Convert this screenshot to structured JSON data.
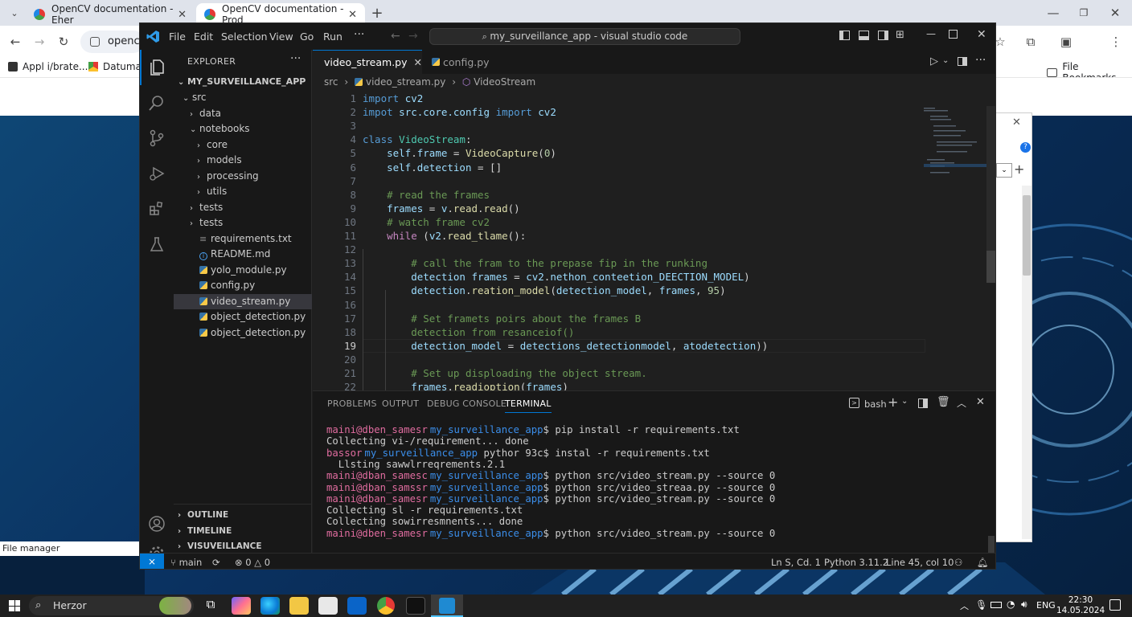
{
  "browser": {
    "tabs": [
      {
        "title": "OpenCV documentation - Eher",
        "active": false
      },
      {
        "title": "OpenCV documentation - Prod",
        "active": true
      }
    ],
    "address_text": "opencv",
    "bookmarks": [
      {
        "label": "Appl i/brate..."
      },
      {
        "label": "Datuman"
      }
    ],
    "bookmarks_folder": "File Bookmarks"
  },
  "desktop": {
    "file_manager_label": "File manager"
  },
  "vscode": {
    "menu": [
      "File",
      "Edit",
      "Selection",
      "View",
      "Go",
      "Run"
    ],
    "command_center": "my_surveillance_app - visual studio code",
    "explorer_title": "EXPLORER",
    "project_name": "MY_SURVEILLANCE_APP",
    "tree": [
      {
        "label": "src",
        "chevron": "⌄",
        "icon": "",
        "depth": 1
      },
      {
        "label": "data",
        "chevron": "›",
        "icon": "",
        "depth": 2
      },
      {
        "label": "notebooks",
        "chevron": "⌄",
        "icon": "",
        "depth": 2
      },
      {
        "label": "core",
        "chevron": "›",
        "icon": "",
        "depth": 3
      },
      {
        "label": "models",
        "chevron": "›",
        "icon": "",
        "depth": 3
      },
      {
        "label": "processing",
        "chevron": "›",
        "icon": "",
        "depth": 3
      },
      {
        "label": "utils",
        "chevron": "›",
        "icon": "",
        "depth": 3
      },
      {
        "label": "tests",
        "chevron": "›",
        "icon": "",
        "depth": 2
      },
      {
        "label": "tests",
        "chevron": "›",
        "icon": "",
        "depth": 2
      },
      {
        "label": "requirements.txt",
        "chevron": "",
        "icon": "text",
        "depth": 2
      },
      {
        "label": "README.md",
        "chevron": "",
        "icon": "info",
        "depth": 2
      },
      {
        "label": "yolo_module.py",
        "chevron": "",
        "icon": "python",
        "depth": 2
      },
      {
        "label": "config.py",
        "chevron": "",
        "icon": "python",
        "depth": 2
      },
      {
        "label": "video_stream.py",
        "chevron": "",
        "icon": "python",
        "depth": 2,
        "selected": true
      },
      {
        "label": "object_detection.py",
        "chevron": "",
        "icon": "python",
        "depth": 2
      },
      {
        "label": "object_detection.py",
        "chevron": "",
        "icon": "python",
        "depth": 2
      }
    ],
    "sidebar_sections": [
      "OUTLINE",
      "TIMELINE",
      "VISUVEILLANCE"
    ],
    "editor_tabs": [
      {
        "label": "video_stream.py",
        "active": true
      },
      {
        "label": "config.py",
        "active": false
      }
    ],
    "breadcrumb": {
      "folder": "src",
      "file": "video_stream.py",
      "symbol": "VideoStream"
    },
    "current_line": 19,
    "code": [
      {
        "n": 1,
        "tokens": [
          [
            "kw",
            "import"
          ],
          [
            "pun",
            " "
          ],
          [
            "var",
            "cv2"
          ]
        ]
      },
      {
        "n": 2,
        "tokens": [
          [
            "kw",
            "impot"
          ],
          [
            "pun",
            " "
          ],
          [
            "var",
            "src.core.config"
          ],
          [
            "pun",
            " "
          ],
          [
            "kw",
            "import"
          ],
          [
            "pun",
            " "
          ],
          [
            "var",
            "cv2"
          ]
        ]
      },
      {
        "n": 3,
        "tokens": []
      },
      {
        "n": 4,
        "tokens": [
          [
            "kw",
            "class"
          ],
          [
            "pun",
            " "
          ],
          [
            "cls",
            "VideoStream"
          ],
          [
            "pun",
            ":"
          ]
        ]
      },
      {
        "n": 5,
        "tokens": [
          [
            "pun",
            "    "
          ],
          [
            "var",
            "self"
          ],
          [
            "pun",
            "."
          ],
          [
            "var",
            "frame"
          ],
          [
            "pun",
            " = "
          ],
          [
            "fn",
            "VideoCapture"
          ],
          [
            "pun",
            "("
          ],
          [
            "num",
            "0"
          ],
          [
            "pun",
            ")"
          ]
        ]
      },
      {
        "n": 6,
        "tokens": [
          [
            "pun",
            "    "
          ],
          [
            "var",
            "self"
          ],
          [
            "pun",
            "."
          ],
          [
            "var",
            "detection"
          ],
          [
            "pun",
            " = []"
          ]
        ]
      },
      {
        "n": 7,
        "tokens": []
      },
      {
        "n": 8,
        "tokens": [
          [
            "pun",
            "    "
          ],
          [
            "com",
            "# read the frames"
          ]
        ]
      },
      {
        "n": 9,
        "tokens": [
          [
            "pun",
            "    "
          ],
          [
            "var",
            "frames"
          ],
          [
            "pun",
            " = "
          ],
          [
            "var",
            "v"
          ],
          [
            "pun",
            "."
          ],
          [
            "fn",
            "read"
          ],
          [
            "pun",
            "."
          ],
          [
            "fn",
            "read"
          ],
          [
            "pun",
            "()"
          ]
        ]
      },
      {
        "n": 10,
        "tokens": [
          [
            "pun",
            "    "
          ],
          [
            "com",
            "# watch frame cv2"
          ]
        ]
      },
      {
        "n": 11,
        "tokens": [
          [
            "pun",
            "    "
          ],
          [
            "kw2",
            "while"
          ],
          [
            "pun",
            " ("
          ],
          [
            "var",
            "v2"
          ],
          [
            "pun",
            "."
          ],
          [
            "fn",
            "read_tlame"
          ],
          [
            "pun",
            "():"
          ]
        ]
      },
      {
        "n": 12,
        "tokens": []
      },
      {
        "n": 13,
        "tokens": [
          [
            "pun",
            "        "
          ],
          [
            "com",
            "# call the fram to the prepase fip in the runking"
          ]
        ]
      },
      {
        "n": 14,
        "tokens": [
          [
            "pun",
            "        "
          ],
          [
            "var",
            "detection"
          ],
          [
            "pun",
            " "
          ],
          [
            "var",
            "frames"
          ],
          [
            "pun",
            " = "
          ],
          [
            "var",
            "cv2"
          ],
          [
            "pun",
            "."
          ],
          [
            "var",
            "nethon"
          ],
          [
            "pun",
            "_"
          ],
          [
            "var",
            "conteetion_DEECTION_MODEL"
          ],
          [
            "pun",
            ")"
          ]
        ]
      },
      {
        "n": 15,
        "tokens": [
          [
            "pun",
            "        "
          ],
          [
            "var",
            "detection"
          ],
          [
            "pun",
            "."
          ],
          [
            "fn",
            "reation_model"
          ],
          [
            "pun",
            "("
          ],
          [
            "var",
            "detection_model"
          ],
          [
            "pun",
            ", "
          ],
          [
            "var",
            "frames"
          ],
          [
            "pun",
            ", "
          ],
          [
            "num",
            "95"
          ],
          [
            "pun",
            ")"
          ]
        ]
      },
      {
        "n": 16,
        "tokens": []
      },
      {
        "n": 17,
        "tokens": [
          [
            "pun",
            "        "
          ],
          [
            "com",
            "# Set framets poirs about the frames B"
          ]
        ]
      },
      {
        "n": 18,
        "tokens": [
          [
            "pun",
            "        "
          ],
          [
            "com",
            "detection from resanceiof()"
          ]
        ]
      },
      {
        "n": 19,
        "tokens": [
          [
            "pun",
            "        "
          ],
          [
            "var",
            "detection_model"
          ],
          [
            "pun",
            " = "
          ],
          [
            "var",
            "detections_detectionmodel"
          ],
          [
            "pun",
            ", "
          ],
          [
            "var",
            "atodetection"
          ],
          [
            "pun",
            "))"
          ]
        ]
      },
      {
        "n": 20,
        "tokens": []
      },
      {
        "n": 21,
        "tokens": [
          [
            "pun",
            "        "
          ],
          [
            "com",
            "# Set up disploading the object stream."
          ]
        ]
      },
      {
        "n": 22,
        "tokens": [
          [
            "pun",
            "        "
          ],
          [
            "var",
            "frames"
          ],
          [
            "pun",
            "."
          ],
          [
            "fn",
            "readioption"
          ],
          [
            "pun",
            "("
          ],
          [
            "var",
            "frames"
          ],
          [
            "pun",
            ")"
          ]
        ]
      }
    ],
    "panel_tabs": [
      "PROBLEMS",
      "OUTPUT",
      "DEBUG CONSOLE",
      "TERMINAL"
    ],
    "panel_active": "TERMINAL",
    "terminal_shell": "bash",
    "terminal": [
      {
        "prompt": "maini@dben_samesr",
        "path": "my_surveillance_app",
        "cmd": "$ pip install -r requirements.txt"
      },
      {
        "prompt": "",
        "path": "",
        "cmd": "Collecting vi-/requirement... done"
      },
      {
        "prompt": "bassor",
        "path": "my_surveillance_app",
        "cmd": " pythor 93c$ instal -r requirements.txt"
      },
      {
        "prompt": "",
        "path": "",
        "cmd": "  Llsting sawwlrreqrements.2.1"
      },
      {
        "prompt": "maini@dban_samesc",
        "path": "my_surveillance_app",
        "cmd": "$ python src/video_stream.py --source 0"
      },
      {
        "prompt": "maini@dban_samssr",
        "path": "my_surveillance_app",
        "cmd": "$ python src/video_streaa.py --source 0"
      },
      {
        "prompt": "maini@dban_samesr",
        "path": "my_surveillance_app",
        "cmd": "$ python src/video_stream.py --source 0"
      },
      {
        "prompt": "",
        "path": "",
        "cmd": "Collecting sl -r requirements.txt"
      },
      {
        "prompt": "",
        "path": "",
        "cmd": "Collecting sowirresmnents... done"
      },
      {
        "prompt": "maini@dben_samesr",
        "path": "my_surveillance_app",
        "cmd": "$ python src/video_stream.py --source 0"
      }
    ],
    "status": {
      "branch": "main",
      "errors": "0",
      "warnings": "0",
      "position": "Ln S, Cd. 1",
      "language": "Python 3.11.2",
      "line_col": "Line 45,  col 10"
    }
  },
  "taskbar": {
    "search_text": "Herzor",
    "lang": "ENG",
    "time": "22:30",
    "date": "14.05.2024"
  },
  "colors": {
    "accent": "#0078d4",
    "remote": "#0078d4"
  }
}
